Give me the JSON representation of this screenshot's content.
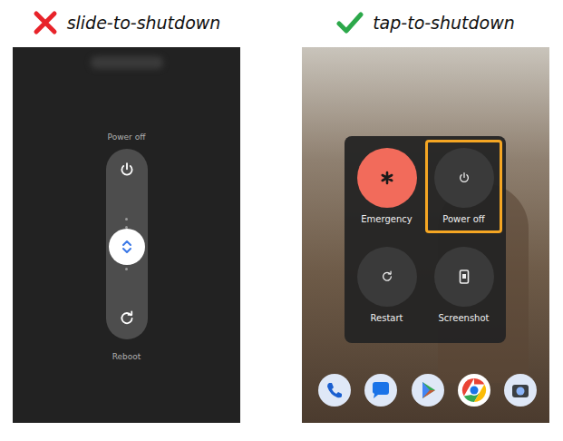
{
  "panels": [
    {
      "title": "slide-to-shutdown",
      "approved": false,
      "kind": "slider",
      "slider": {
        "top_label": "Power off",
        "bottom_label": "Reboot",
        "level": 0.5
      }
    },
    {
      "title": "tap-to-shutdown",
      "approved": true,
      "kind": "menu",
      "menu": [
        {
          "label": "Emergency",
          "color": "#f26b5b",
          "selected": false
        },
        {
          "label": "Power off",
          "color": "#3a3a3a",
          "selected": true
        },
        {
          "label": "Restart",
          "color": "#3a3a3a",
          "selected": false
        },
        {
          "label": "Screenshot",
          "color": "#3a3a3a",
          "selected": false
        }
      ]
    }
  ]
}
